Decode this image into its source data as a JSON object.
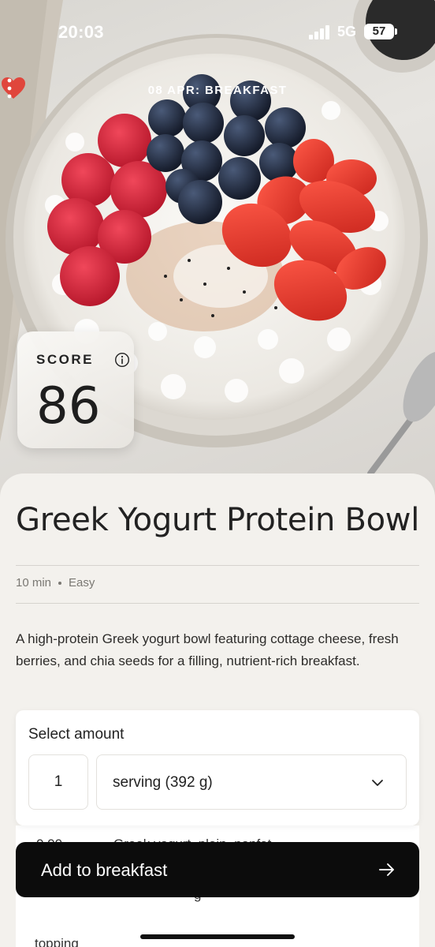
{
  "status_bar": {
    "time": "20:03",
    "network": "5G",
    "battery": "57"
  },
  "nav": {
    "title": "08 APR: BREAKFAST"
  },
  "score": {
    "label": "SCORE",
    "value": "86"
  },
  "recipe": {
    "title": "Greek Yogurt Protein Bowl",
    "time": "10 min",
    "difficulty": "Easy",
    "description": "A high-protein Greek yogurt bowl featuring cottage cheese, fresh berries, and chia seeds for a filling, nutrient-rich breakfast."
  },
  "amount": {
    "label": "Select amount",
    "quantity": "1",
    "unit": "serving (392 g)"
  },
  "ingredients": {
    "row1_amount": "0.00",
    "row1_name": "Greek yogurt, plain, nonfat",
    "row2_name": "g",
    "section": "topping"
  },
  "cta": {
    "label": "Add to breakfast"
  },
  "colors": {
    "heart": "#e0463c",
    "cta_bg": "#0c0c0c",
    "sheet_bg": "#f3f1ed"
  }
}
